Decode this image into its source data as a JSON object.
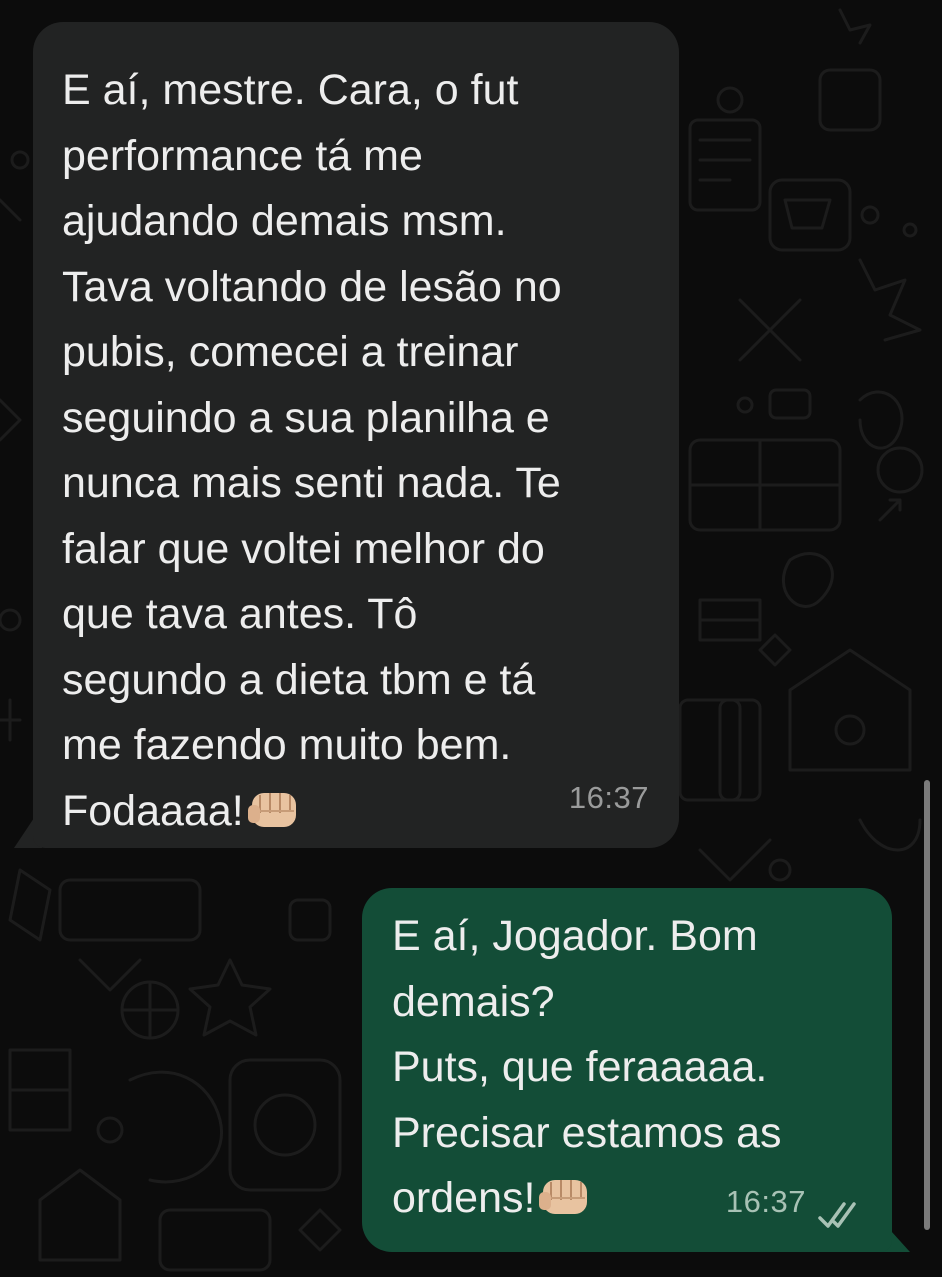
{
  "incoming_message": {
    "lines": [
      "E aí, mestre. Cara, o fut",
      "performance tá me",
      "ajudando demais msm.",
      "Tava voltando de lesão no",
      "pubis, comecei a treinar",
      "seguindo a sua planilha e",
      "nunca mais senti nada. Te",
      "falar que voltei melhor do",
      "que tava antes. Tô",
      "segundo a dieta tbm e tá",
      "me fazendo muito bem.",
      "Fodaaaa!"
    ],
    "emoji": "fist-bump-icon",
    "time": "16:37"
  },
  "outgoing_message": {
    "lines": [
      "E aí, Jogador. Bom",
      "demais?",
      "Puts, que feraaaaa.",
      "Precisar estamos as",
      "ordens!"
    ],
    "emoji": "fist-bump-icon",
    "time": "16:37",
    "status_icon": "double-check-read-icon"
  },
  "colors": {
    "background": "#0c0c0c",
    "incoming_bubble": "#222323",
    "outgoing_bubble": "#134d37",
    "text": "#ededed",
    "timestamp": "#9a9b9b"
  }
}
